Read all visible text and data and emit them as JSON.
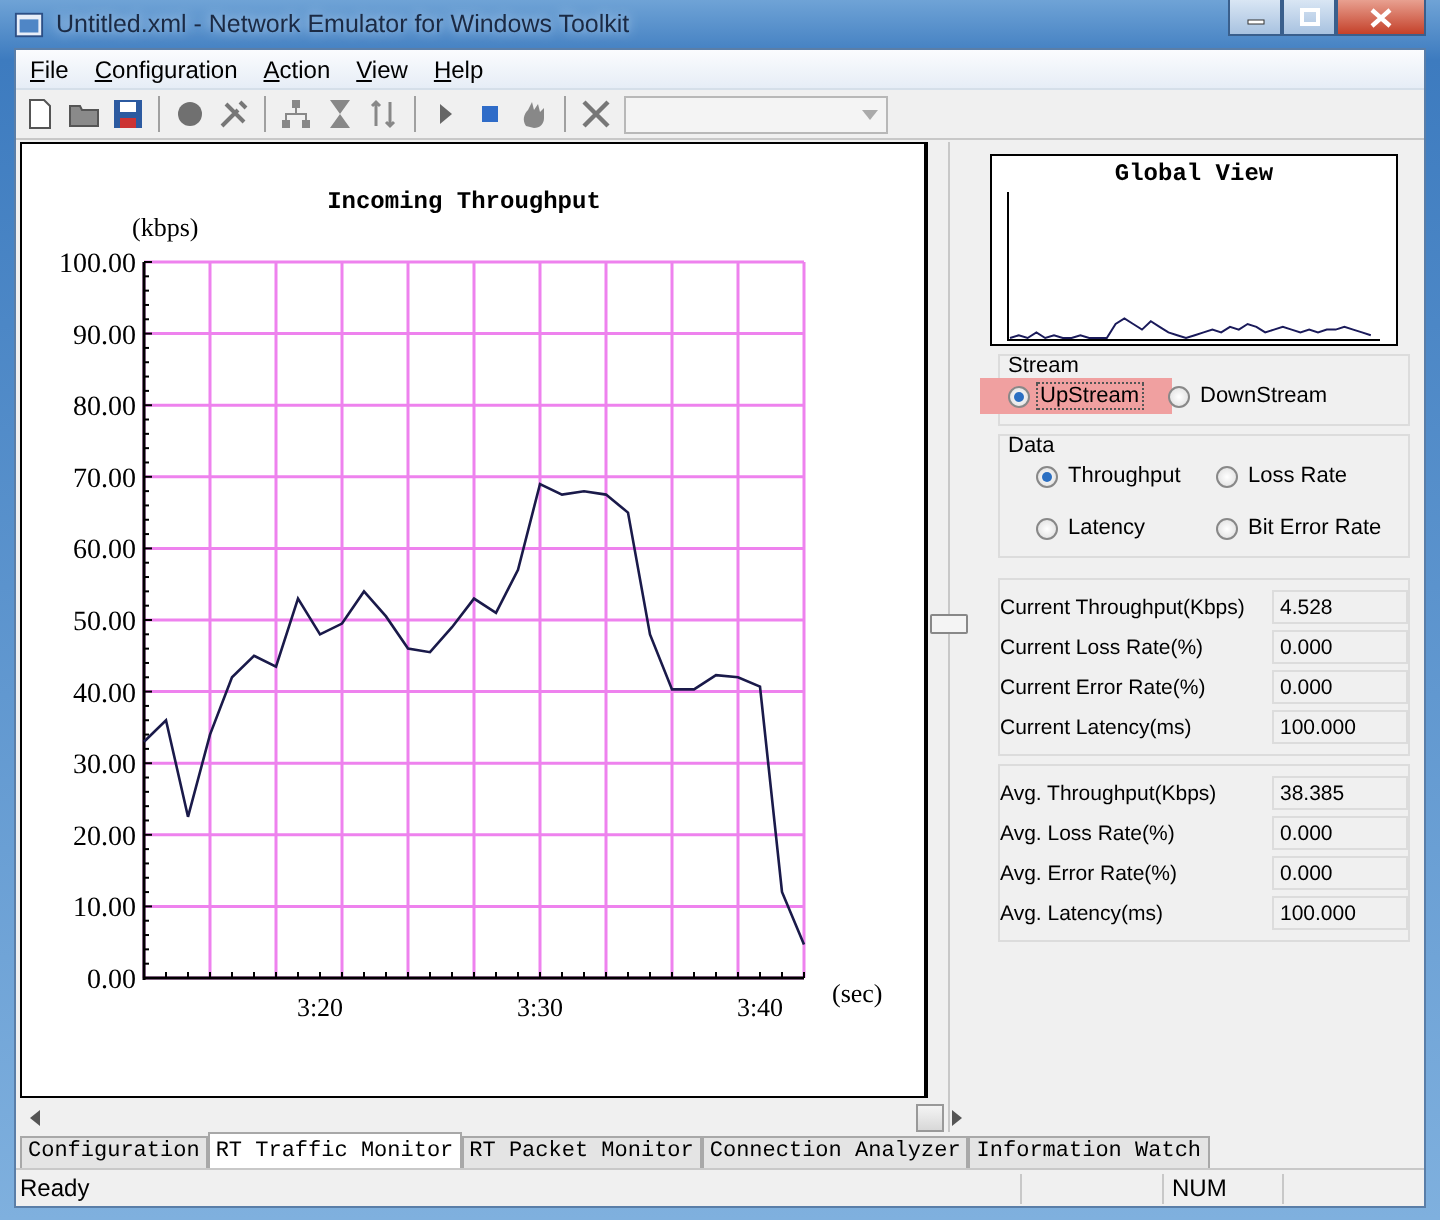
{
  "window": {
    "title": "Untitled.xml - Network Emulator for Windows Toolkit"
  },
  "menu": [
    {
      "label": "File"
    },
    {
      "label": "Configuration"
    },
    {
      "label": "Action"
    },
    {
      "label": "View"
    },
    {
      "label": "Help"
    }
  ],
  "chart": {
    "chart_data": {
      "type": "line",
      "title": "Incoming Throughput",
      "xlabel": "(sec)",
      "ylabel": "(kbps)",
      "x": [
        192,
        193,
        194,
        195,
        196,
        197,
        198,
        199,
        200,
        201,
        202,
        203,
        204,
        205,
        206,
        207,
        208,
        209,
        210,
        211,
        212,
        213,
        214,
        215,
        216,
        217,
        218,
        219,
        220,
        221,
        222
      ],
      "grid": true,
      "series": [
        {
          "color": "#1a1a4a",
          "values": [
            33,
            36,
            22.5,
            34,
            42,
            45,
            43.5,
            53,
            48,
            49.5,
            54,
            50.5,
            46,
            45.5,
            49,
            53,
            51,
            57,
            69,
            67.5,
            68,
            67.5,
            65,
            48,
            40.3,
            40.3,
            42.3,
            42,
            40.7,
            12,
            4.7
          ]
        }
      ],
      "xlim": [
        192,
        222
      ],
      "ylim": [
        0,
        100
      ],
      "xticks": [
        {
          "value": 200,
          "label": "3:20"
        },
        {
          "value": 210,
          "label": "3:30"
        },
        {
          "value": 220,
          "label": "3:40"
        }
      ],
      "yticks": [
        {
          "value": 0,
          "label": "0.00"
        },
        {
          "value": 10,
          "label": "10.00"
        },
        {
          "value": 20,
          "label": "20.00"
        },
        {
          "value": 30,
          "label": "30.00"
        },
        {
          "value": 40,
          "label": "40.00"
        },
        {
          "value": 50,
          "label": "50.00"
        },
        {
          "value": 60,
          "label": "60.00"
        },
        {
          "value": 70,
          "label": "70.00"
        },
        {
          "value": 80,
          "label": "80.00"
        },
        {
          "value": 90,
          "label": "90.00"
        },
        {
          "value": 100,
          "label": "100.00"
        }
      ]
    }
  },
  "global_view": {
    "title": "Global View"
  },
  "stream": {
    "label": "Stream",
    "options": [
      {
        "label": "UpStream",
        "selected": true,
        "focused": true
      },
      {
        "label": "DownStream",
        "selected": false,
        "focused": false
      }
    ]
  },
  "data": {
    "label": "Data",
    "options": [
      {
        "label": "Throughput",
        "selected": true
      },
      {
        "label": "Loss Rate",
        "selected": false
      },
      {
        "label": "Latency",
        "selected": false
      },
      {
        "label": "Bit Error Rate",
        "selected": false
      }
    ]
  },
  "current": [
    {
      "label": "Current Throughput(Kbps)",
      "value": "4.528"
    },
    {
      "label": "Current Loss Rate(%)",
      "value": "0.000"
    },
    {
      "label": "Current Error Rate(%)",
      "value": "0.000"
    },
    {
      "label": "Current Latency(ms)",
      "value": "100.000"
    }
  ],
  "average": [
    {
      "label": "Avg. Throughput(Kbps)",
      "value": "38.385"
    },
    {
      "label": "Avg. Loss Rate(%)",
      "value": "0.000"
    },
    {
      "label": "Avg. Error Rate(%)",
      "value": "0.000"
    },
    {
      "label": "Avg. Latency(ms)",
      "value": "100.000"
    }
  ],
  "tabs": [
    {
      "label": "Configuration",
      "selected": false
    },
    {
      "label": "RT Traffic Monitor",
      "selected": true
    },
    {
      "label": "RT Packet Monitor",
      "selected": false
    },
    {
      "label": "Connection Analyzer",
      "selected": false
    },
    {
      "label": "Information Watch",
      "selected": false
    }
  ],
  "status_bar": {
    "text": "Ready",
    "indicators": [
      "NUM"
    ]
  }
}
